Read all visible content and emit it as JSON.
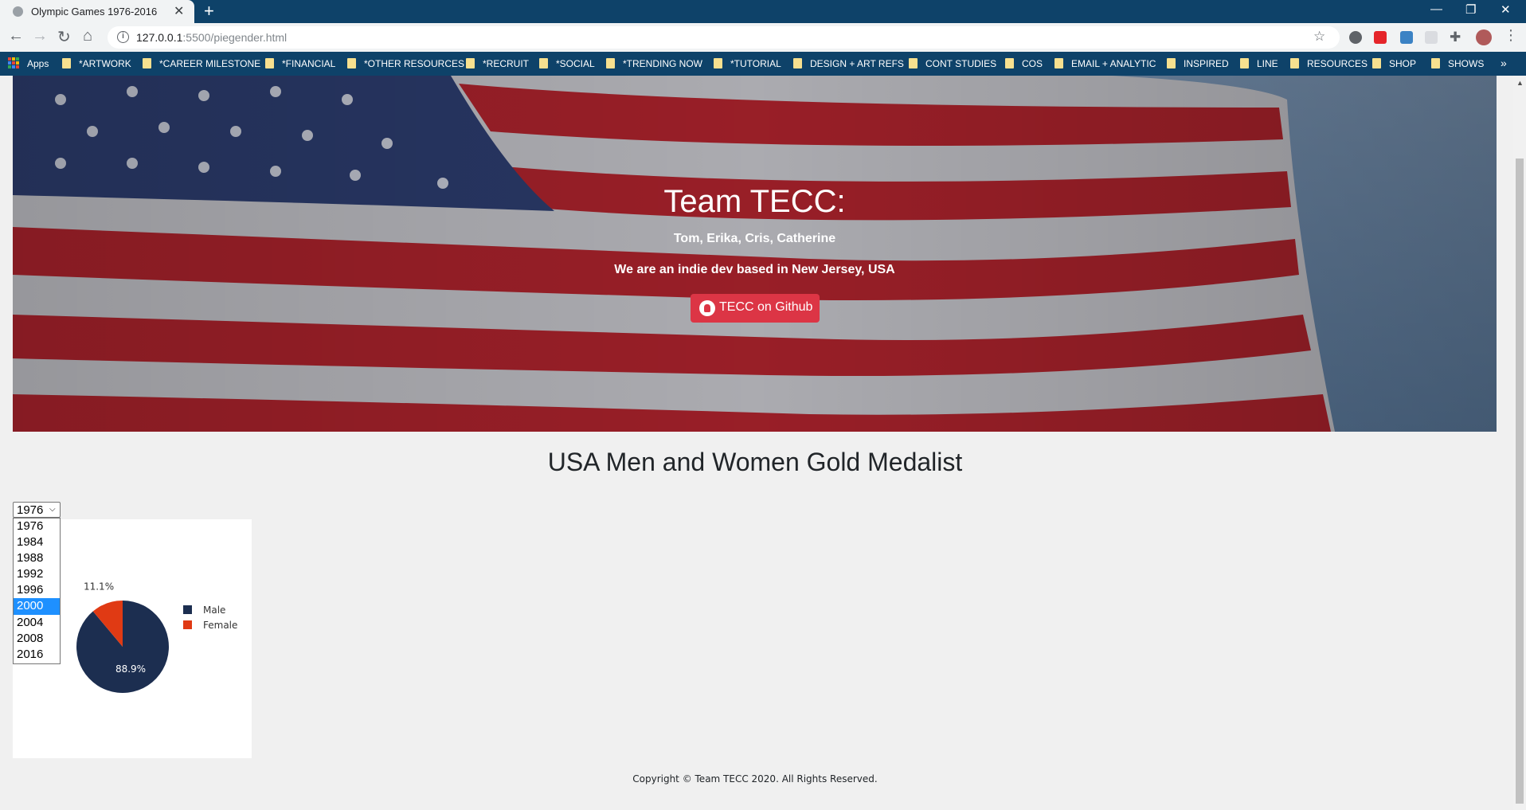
{
  "browser": {
    "tab_title": "Olympic Games 1976-2016",
    "url_host": "127.0.0.1",
    "url_path": ":5500/piegender.html",
    "bookmarks": [
      "Apps",
      "*ARTWORK",
      "*CAREER MILESTONE",
      "*FINANCIAL",
      "*OTHER RESOURCES",
      "*RECRUIT",
      "*SOCIAL",
      "*TRENDING NOW",
      "*TUTORIAL",
      "DESIGN + ART REFS",
      "CONT STUDIES",
      "COS",
      "EMAIL + ANALYTIC",
      "INSPIRED",
      "LINE",
      "RESOURCES",
      "SHOP",
      "SHOWS"
    ]
  },
  "hero": {
    "title": "Team TECC:",
    "names": "Tom, Erika, Cris, Catherine",
    "tagline": "We are an indie dev based in New Jersey, USA",
    "github_label": "TECC on Github"
  },
  "section_title": "USA Men and Women Gold Medalist",
  "year_select": {
    "selected": "1976",
    "highlighted": "2000",
    "options": [
      "1976",
      "1984",
      "1988",
      "1992",
      "1996",
      "2000",
      "2004",
      "2008",
      "2016"
    ]
  },
  "chart_data": {
    "type": "pie",
    "categories": [
      "Male",
      "Female"
    ],
    "values": [
      88.9,
      11.1
    ],
    "labels": [
      "88.9%",
      "11.1%"
    ],
    "colors": [
      "#1c2e50",
      "#e03a14"
    ],
    "legend": "right"
  },
  "footer": "Copyright © Team TECC 2020. All Rights Reserved."
}
